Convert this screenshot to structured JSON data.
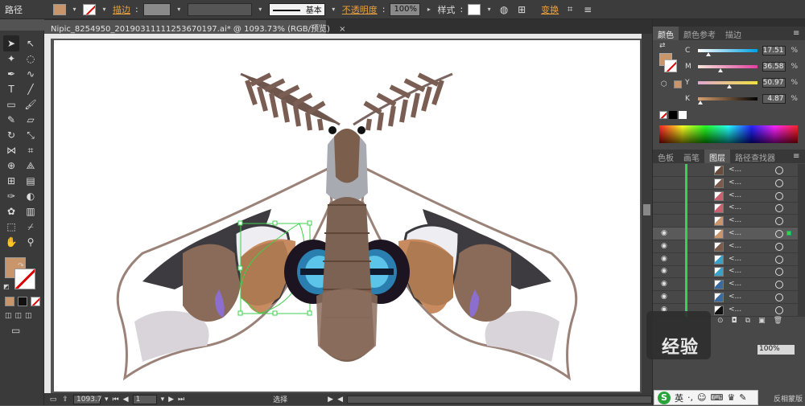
{
  "control_bar": {
    "object_type": "路径",
    "fill_color": "#c8966a",
    "stroke_label": "描边",
    "stroke_style": "基本",
    "opacity_label": "不透明度",
    "opacity_value": "100%",
    "style_label": "样式",
    "transform_label": "变换"
  },
  "document_tab": {
    "title": "Nipic_8254950_20190311111253670197.ai* @ 1093.73% (RGB/预览)",
    "close": "×"
  },
  "status_bar": {
    "zoom": "1093.7",
    "page": "1",
    "tool_status": "选择"
  },
  "toolbox": {
    "fill_color": "#c8966a",
    "icons": [
      "selection-icon",
      "direct-selection-icon",
      "magic-wand-icon",
      "lasso-icon",
      "pen-icon",
      "curvature-icon",
      "type-icon",
      "line-icon",
      "rectangle-icon",
      "paintbrush-icon",
      "pencil-icon",
      "eraser-icon",
      "rotate-icon",
      "scale-icon",
      "width-icon",
      "free-transform-icon",
      "shape-builder-icon",
      "perspective-icon",
      "mesh-icon",
      "gradient-icon",
      "eyedropper-icon",
      "blend-icon",
      "symbol-icon",
      "graph-icon",
      "artboard-icon",
      "slice-icon",
      "hand-icon",
      "zoom-icon"
    ]
  },
  "color_panel": {
    "tabs": [
      "颜色",
      "颜色参考",
      "描边"
    ],
    "active_tab": 0,
    "swatch": "#c8966a",
    "channels": [
      {
        "name": "C",
        "value": "17.51",
        "knob": 0.1751,
        "gradient": "linear-gradient(to right,#fff,#00a0e0)"
      },
      {
        "name": "M",
        "value": "36.58",
        "knob": 0.3658,
        "gradient": "linear-gradient(to right,#f5e6d8,#e040a0)"
      },
      {
        "name": "Y",
        "value": "50.97",
        "knob": 0.5097,
        "gradient": "linear-gradient(to right,#e0a8d0,#f0e040)"
      },
      {
        "name": "K",
        "value": "4.87",
        "knob": 0.0487,
        "gradient": "linear-gradient(to right,#d8a070,#000)"
      }
    ],
    "percent": "%"
  },
  "layers_panel": {
    "tabs": [
      "色板",
      "画笔",
      "图层",
      "路径查找器"
    ],
    "active_tab": 2,
    "rows": [
      {
        "eye": false,
        "thumb": "#6a4c3c",
        "name": "<...",
        "selected": false
      },
      {
        "eye": false,
        "thumb": "#7a5a4a",
        "name": "<...",
        "selected": false
      },
      {
        "eye": false,
        "thumb": "#c86070",
        "name": "<...",
        "selected": false
      },
      {
        "eye": false,
        "thumb": "#c86070",
        "name": "<...",
        "selected": false
      },
      {
        "eye": false,
        "thumb": "#c8966a",
        "name": "<...",
        "selected": false
      },
      {
        "eye": true,
        "thumb": "#c8966a",
        "name": "<...",
        "selected": true
      },
      {
        "eye": true,
        "thumb": "#7a5a4a",
        "name": "<...",
        "selected": false
      },
      {
        "eye": true,
        "thumb": "#3aa0c8",
        "name": "<...",
        "selected": false
      },
      {
        "eye": true,
        "thumb": "#3aa0c8",
        "name": "<...",
        "selected": false
      },
      {
        "eye": true,
        "thumb": "#3a6aa0",
        "name": "<...",
        "selected": false
      },
      {
        "eye": true,
        "thumb": "#3a6aa0",
        "name": "<...",
        "selected": false
      },
      {
        "eye": true,
        "thumb": "#111111",
        "name": "<...",
        "selected": false
      }
    ]
  },
  "partial": {
    "right_field": "100%",
    "watermark": "经验",
    "ime_lang": "英",
    "bottom_hint": "反相蒙版"
  }
}
